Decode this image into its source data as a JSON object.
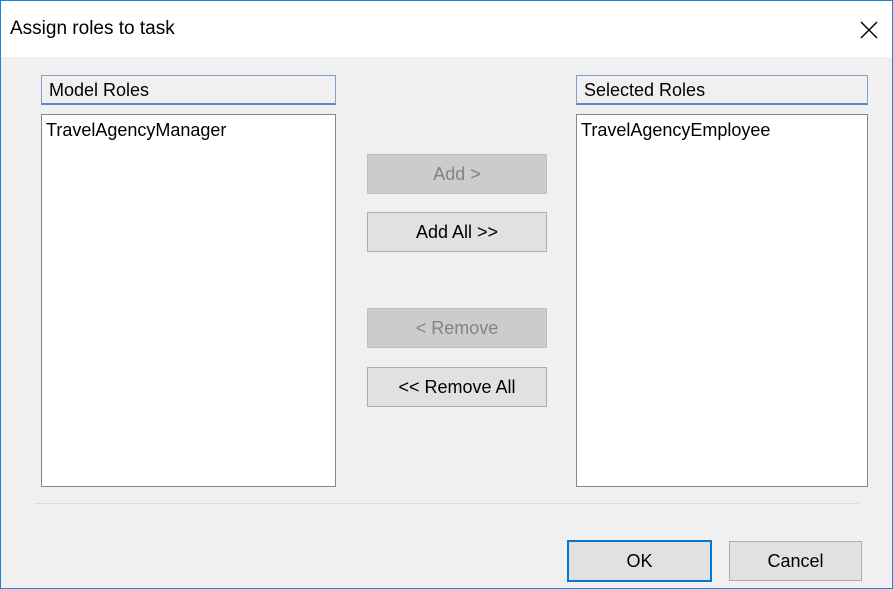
{
  "window": {
    "title": "Assign roles to task",
    "close_glyph": "✕"
  },
  "model_roles": {
    "header": "Model Roles",
    "items": [
      "TravelAgencyManager"
    ]
  },
  "selected_roles": {
    "header": "Selected Roles",
    "items": [
      "TravelAgencyEmployee"
    ]
  },
  "buttons": {
    "add": "Add >",
    "add_all": "Add All >>",
    "remove": "< Remove",
    "remove_all": "<< Remove All",
    "ok": "OK",
    "cancel": "Cancel"
  },
  "colors": {
    "accent": "#0078d7",
    "window_border": "#1883d7"
  }
}
